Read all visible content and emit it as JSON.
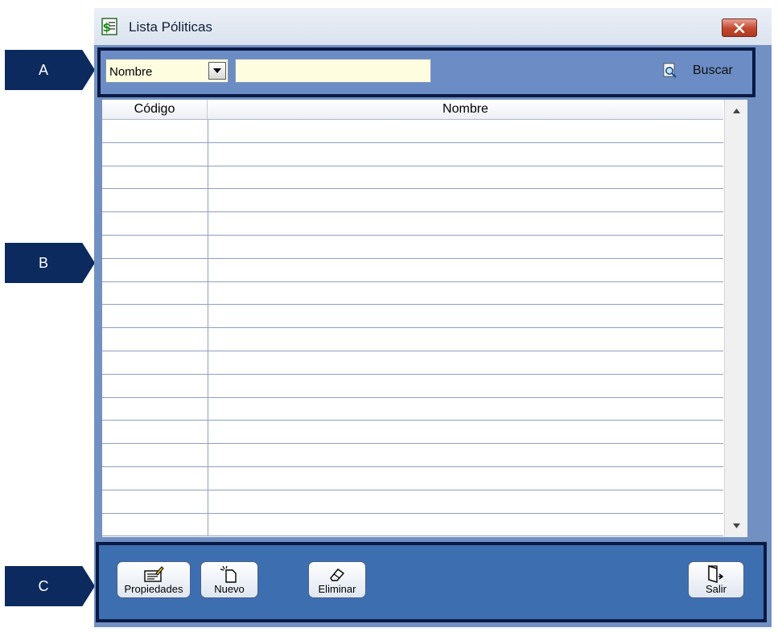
{
  "callouts": [
    "A",
    "B",
    "C"
  ],
  "window": {
    "title": "Lista Póliticas"
  },
  "search": {
    "field_value": "Nombre",
    "query_value": "",
    "buscar_label": "Buscar"
  },
  "grid": {
    "columns": [
      "Código",
      "Nombre"
    ],
    "row_count": 18
  },
  "toolbar": {
    "propiedades_label": "Propiedades",
    "nuevo_label": "Nuevo",
    "eliminar_label": "Eliminar",
    "salir_label": "Salir"
  },
  "icons": {
    "app": "dollar-list-icon",
    "close": "close-icon",
    "dropdown": "chevron-down-icon",
    "buscar": "magnifier-icon",
    "propiedades": "properties-icon",
    "nuevo": "new-document-icon",
    "eliminar": "eraser-icon",
    "salir": "exit-door-icon"
  },
  "colors": {
    "window_bg": "#7291c2",
    "search_bar": "#6b8cc4",
    "toolbar": "#3d6fb0",
    "callout": "#0c2a5e",
    "input_bg": "#fffde0",
    "close_button": "#c2472f"
  }
}
